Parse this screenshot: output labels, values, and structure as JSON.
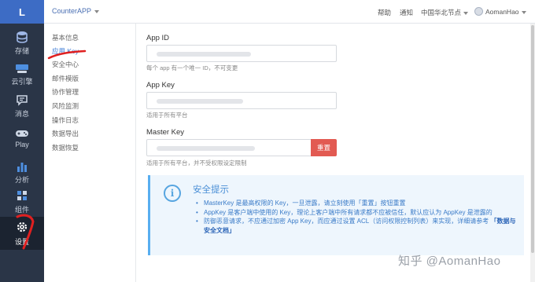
{
  "logo": {
    "letter": "L"
  },
  "rail": [
    {
      "label": "存储",
      "icon": "database-icon"
    },
    {
      "label": "云引擎",
      "icon": "cloud-engine-icon"
    },
    {
      "label": "消息",
      "icon": "message-icon"
    },
    {
      "label": "Play",
      "icon": "gamepad-icon"
    },
    {
      "label": "分析",
      "icon": "bar-chart-icon"
    },
    {
      "label": "组件",
      "icon": "component-icon"
    },
    {
      "label": "设置",
      "icon": "gear-icon",
      "active": true
    }
  ],
  "topbar": {
    "app_name": "CounterAPP",
    "help": "帮助",
    "notifications": "通知",
    "region": "中国华北节点",
    "user": "AomanHao"
  },
  "subnav": [
    "基本信息",
    "应用 Key",
    "安全中心",
    "邮件模版",
    "协作管理",
    "风险监测",
    "操作日志",
    "数据导出",
    "数据恢复"
  ],
  "subnav_active": "应用 Key",
  "fields": {
    "app_id": {
      "label": "App ID",
      "hint": "每个 app 有一个唯一 ID，不可变更"
    },
    "app_key": {
      "label": "App Key",
      "hint": "适用于所有平台"
    },
    "master_key": {
      "label": "Master Key",
      "hint": "适用于所有平台，并不受权限设定限制",
      "reset_label": "重置"
    }
  },
  "notice": {
    "title": "安全提示",
    "items": [
      "MasterKey 是最高权限的 Key，一旦泄露，请立刻使用「重置」按钮重置",
      "AppKey 是客户端中使用的 Key，理论上客户端中所有请求都不应被信任，默认应认为 AppKey 是泄露的"
    ],
    "item3_text": "防御恶意请求，不应通过加密 App Key，而应通过设置 ACL（访问权限控制列表）来实现，详细请参考",
    "item3_link": "「数据与安全文档」"
  },
  "watermark": "知乎 @AomanHao",
  "colors": {
    "rail_bg": "#2a3547",
    "logo_bg": "#3d6cc5",
    "accent": "#3d7bd6",
    "reset": "#e25a52",
    "notice_bg": "#eef6fd"
  }
}
